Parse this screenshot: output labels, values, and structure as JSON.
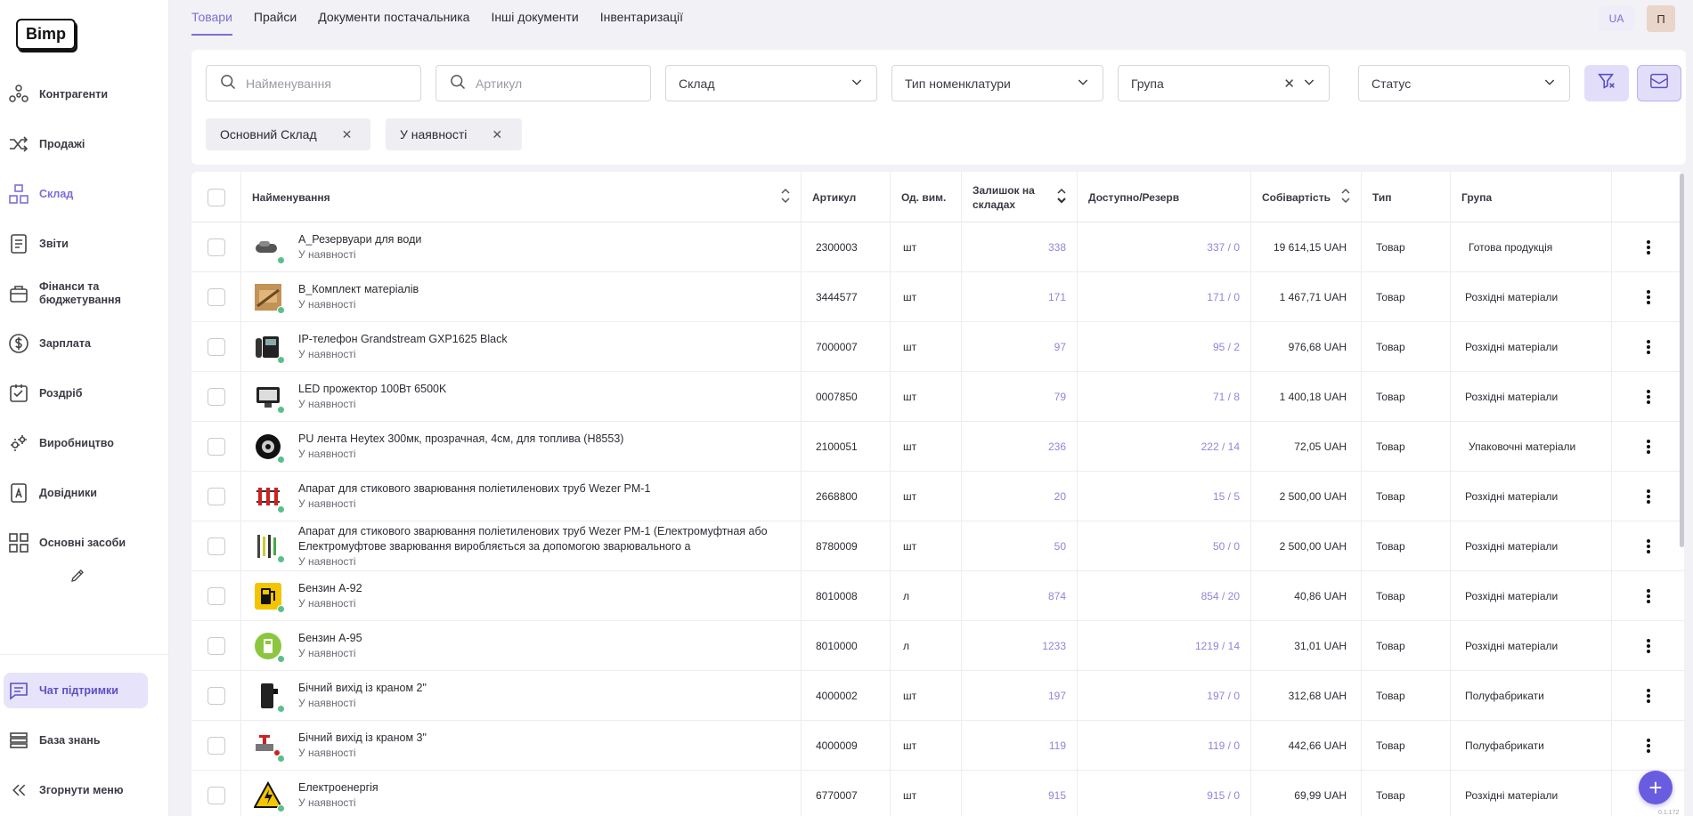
{
  "brand": {
    "logo_text": "Bimp"
  },
  "sidebar": {
    "items": [
      {
        "label": "Контрагенти",
        "icon": "contractors-icon"
      },
      {
        "label": "Продажі",
        "icon": "sales-icon"
      },
      {
        "label": "Склад",
        "icon": "warehouse-icon",
        "active": true
      },
      {
        "label": "Звіти",
        "icon": "reports-icon"
      },
      {
        "label": "Фінанси та бюджетування",
        "icon": "finance-icon"
      },
      {
        "label": "Зарплата",
        "icon": "salary-icon"
      },
      {
        "label": "Роздріб",
        "icon": "retail-icon"
      },
      {
        "label": "Виробництво",
        "icon": "production-icon"
      },
      {
        "label": "Довідники",
        "icon": "directories-icon"
      },
      {
        "label": "Основні засоби",
        "icon": "fixed-assets-icon"
      }
    ],
    "bottom": {
      "chat": "Чат підтримки",
      "knowledge": "База знань",
      "collapse": "Згорнути меню"
    }
  },
  "header": {
    "tabs": [
      "Товари",
      "Прайси",
      "Документи постачальника",
      "Інші документи",
      "Інвентаризації"
    ],
    "active_tab": "Товари",
    "language": "UA",
    "avatar_initial": "П"
  },
  "filters": {
    "name_placeholder": "Найменування",
    "article_placeholder": "Артикул",
    "warehouse": "Склад",
    "nomenclature_type": "Тип номенклатури",
    "group": "Група",
    "status": "Статус",
    "chips": [
      "Основний Склад",
      "У наявності"
    ]
  },
  "table": {
    "headers": {
      "name": "Найменування",
      "article": "Артикул",
      "unit": "Од. вим.",
      "stock": "Залишок на складах",
      "available": "Доступно/Резерв",
      "cost": "Собівартість",
      "type": "Тип",
      "group": "Група"
    },
    "rows": [
      {
        "name": "A_Резервуари для води",
        "name2": "",
        "status": "У наявності",
        "article": "2300003",
        "unit": "шт",
        "stock": "338",
        "available": "337 / 0",
        "cost": "19 614,15 UAH",
        "type": "Товар",
        "group": "Готова продукція"
      },
      {
        "name": "B_Комплект матеріалів",
        "name2": "",
        "status": "У наявності",
        "article": "3444577",
        "unit": "шт",
        "stock": "171",
        "available": "171 / 0",
        "cost": "1 467,71 UAH",
        "type": "Товар",
        "group": "Розхідні матеріали"
      },
      {
        "name": "IP-телефон Grandstream GXP1625 Black",
        "name2": "",
        "status": "У наявності",
        "article": "7000007",
        "unit": "шт",
        "stock": "97",
        "available": "95 / 2",
        "cost": "976,68 UAH",
        "type": "Товар",
        "group": "Розхідні матеріали"
      },
      {
        "name": "LED прожектор 100Вт 6500K",
        "name2": "",
        "status": "У наявності",
        "article": "0007850",
        "unit": "шт",
        "stock": "79",
        "available": "71 / 8",
        "cost": "1 400,18 UAH",
        "type": "Товар",
        "group": "Розхідні матеріали"
      },
      {
        "name": "PU лента Heytex 300мк, прозрачная, 4см, для топлива (H8553)",
        "name2": "",
        "status": "У наявності",
        "article": "2100051",
        "unit": "шт",
        "stock": "236",
        "available": "222 / 14",
        "cost": "72,05 UAH",
        "type": "Товар",
        "group": "Упаковочні матеріали"
      },
      {
        "name": "Апарат для стикового зварювання поліетиленових труб Wezer PM-1",
        "name2": "",
        "status": "У наявності",
        "article": "2668800",
        "unit": "шт",
        "stock": "20",
        "available": "15 / 5",
        "cost": "2 500,00 UAH",
        "type": "Товар",
        "group": "Розхідні матеріали"
      },
      {
        "name": "Апарат для стикового зварювання поліетиленових труб Wezer PM-1 (Електромуфтная або",
        "name2": "Електромуфтове зварювання виробляється за допомогою зварювального а",
        "status": "У наявності",
        "article": "8780009",
        "unit": "шт",
        "stock": "50",
        "available": "50 / 0",
        "cost": "2 500,00 UAH",
        "type": "Товар",
        "group": "Розхідні матеріали"
      },
      {
        "name": "Бензин А-92",
        "name2": "",
        "status": "У наявності",
        "article": "8010008",
        "unit": "л",
        "stock": "874",
        "available": "854 / 20",
        "cost": "40,86 UAH",
        "type": "Товар",
        "group": "Розхідні матеріали"
      },
      {
        "name": "Бензин А-95",
        "name2": "",
        "status": "У наявності",
        "article": "8010000",
        "unit": "л",
        "stock": "1233",
        "available": "1219 / 14",
        "cost": "31,01 UAH",
        "type": "Товар",
        "group": "Розхідні матеріали"
      },
      {
        "name": "Бічний вихід із краном 2\"",
        "name2": "",
        "status": "У наявності",
        "article": "4000002",
        "unit": "шт",
        "stock": "197",
        "available": "197 / 0",
        "cost": "312,68 UAH",
        "type": "Товар",
        "group": "Полуфабрикати"
      },
      {
        "name": "Бічний вихід із краном 3\"",
        "name2": "",
        "status": "У наявності",
        "article": "4000009",
        "unit": "шт",
        "stock": "119",
        "available": "119 / 0",
        "cost": "442,66 UAH",
        "type": "Товар",
        "group": "Полуфабрикати"
      },
      {
        "name": "Електроенергія",
        "name2": "",
        "status": "У наявності",
        "article": "6770007",
        "unit": "шт",
        "stock": "915",
        "available": "915 / 0",
        "cost": "69,99 UAH",
        "type": "Товар",
        "group": "Розхідні матеріали"
      }
    ]
  },
  "footer": {
    "version": "0.1.172"
  },
  "colors": {
    "accent": "#7b6fd6",
    "in_stock_dot": "#5bbf8a",
    "fab": "#6a5ce0"
  }
}
